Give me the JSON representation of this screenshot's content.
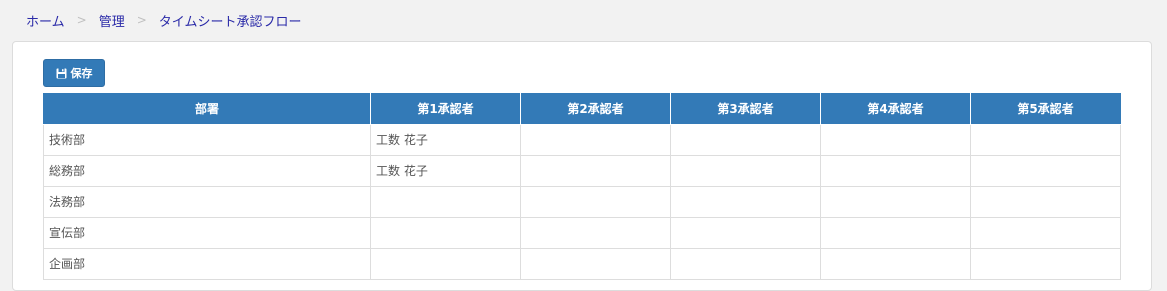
{
  "breadcrumb": {
    "items": [
      "ホーム",
      "管理",
      "タイムシート承認フロー"
    ],
    "separator": ">"
  },
  "toolbar": {
    "save_label": "保存",
    "save_icon": "floppy-disk-icon"
  },
  "table": {
    "headers": [
      "部署",
      "第1承認者",
      "第2承認者",
      "第3承認者",
      "第4承認者",
      "第5承認者"
    ],
    "rows": [
      {
        "dept": "技術部",
        "approvers": [
          "工数 花子",
          "",
          "",
          "",
          ""
        ]
      },
      {
        "dept": "総務部",
        "approvers": [
          "工数 花子",
          "",
          "",
          "",
          ""
        ]
      },
      {
        "dept": "法務部",
        "approvers": [
          "",
          "",
          "",
          "",
          ""
        ]
      },
      {
        "dept": "宣伝部",
        "approvers": [
          "",
          "",
          "",
          "",
          ""
        ]
      },
      {
        "dept": "企画部",
        "approvers": [
          "",
          "",
          "",
          "",
          ""
        ]
      }
    ]
  },
  "colors": {
    "accent": "#337ab7",
    "link": "#2a2aa8",
    "background": "#f2f2f2"
  }
}
